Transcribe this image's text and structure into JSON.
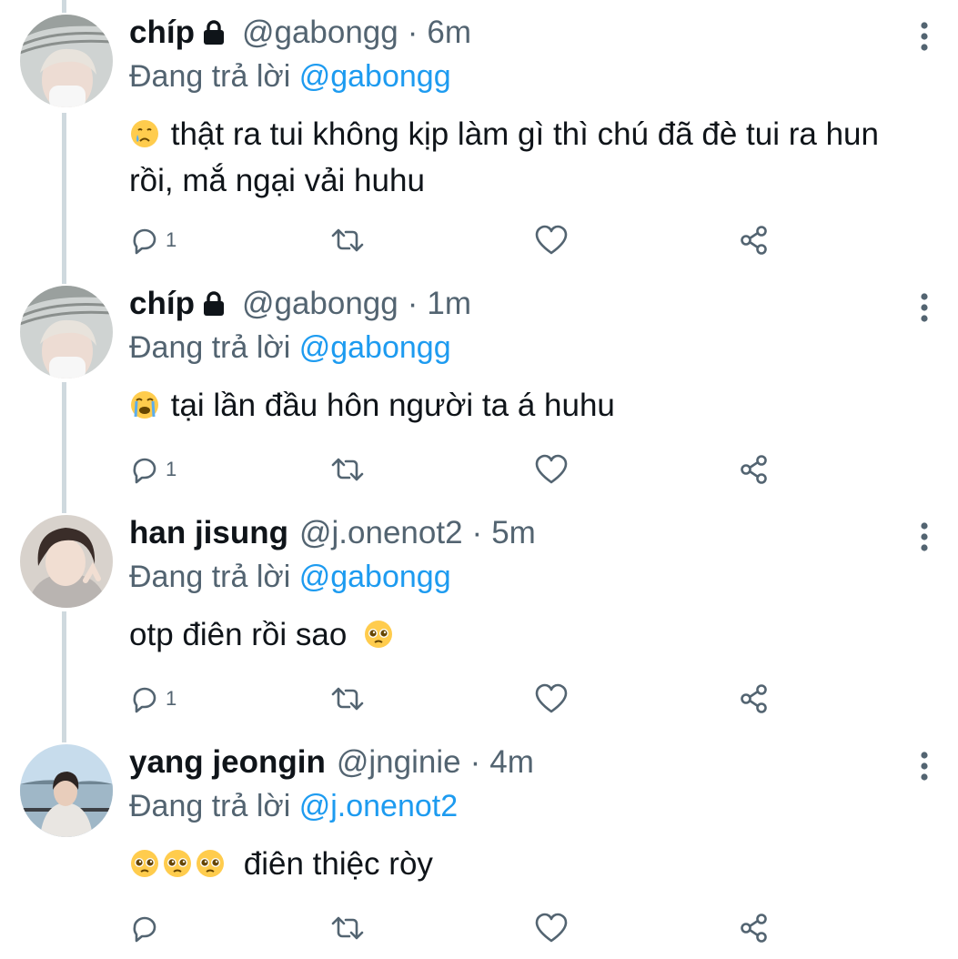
{
  "tweets": [
    {
      "display_name": "chíp",
      "locked": true,
      "handle": "@gabongg",
      "separator": "·",
      "time": "6m",
      "reply_prefix": "Đang trả lời",
      "reply_target": "@gabongg",
      "emojis": [
        "crying-face"
      ],
      "text": "thật ra tui không kịp làm gì thì chú đã đè tui ra hun rồi, mắ ngại vải huhu",
      "reply_count": "1"
    },
    {
      "display_name": "chíp",
      "locked": true,
      "handle": "@gabongg",
      "separator": "·",
      "time": "1m",
      "reply_prefix": "Đang trả lời",
      "reply_target": "@gabongg",
      "emojis": [
        "loudly-crying-face"
      ],
      "text": "tại lần đầu hôn người ta á huhu",
      "reply_count": "1"
    },
    {
      "display_name": "han jisung",
      "locked": false,
      "handle": "@j.onenot2",
      "separator": "·",
      "time": "5m",
      "reply_prefix": "Đang trả lời",
      "reply_target": "@gabongg",
      "emojis_after": [
        "pleading-face"
      ],
      "text": "otp điên rồi sao",
      "reply_count": "1"
    },
    {
      "display_name": "yang jeongin",
      "locked": false,
      "handle": "@jnginie",
      "separator": "·",
      "time": "4m",
      "reply_prefix": "Đang trả lời",
      "reply_target": "@j.onenot2",
      "emojis": [
        "pleading-face",
        "pleading-face",
        "pleading-face"
      ],
      "text": "điên thiệc ròy",
      "reply_count": ""
    }
  ],
  "icons": {
    "reply": "reply-icon",
    "retweet": "retweet-icon",
    "like": "heart-icon",
    "share": "share-icon",
    "more": "more-vertical-icon",
    "lock": "lock-icon"
  },
  "colors": {
    "text": "#0f1419",
    "secondary": "#536471",
    "link": "#1d9bf0",
    "thread_line": "#cfd9de"
  }
}
